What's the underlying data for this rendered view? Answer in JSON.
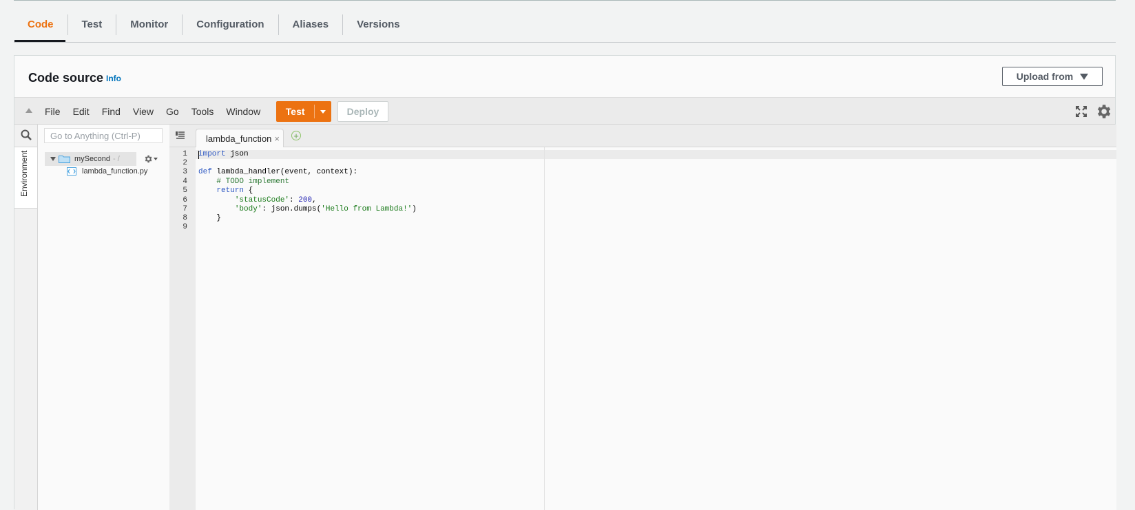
{
  "tabs": [
    {
      "label": "Code",
      "active": true
    },
    {
      "label": "Test"
    },
    {
      "label": "Monitor"
    },
    {
      "label": "Configuration"
    },
    {
      "label": "Aliases"
    },
    {
      "label": "Versions"
    }
  ],
  "code_source": {
    "title": "Code source",
    "info": "Info",
    "upload_label": "Upload from"
  },
  "ide_menu": [
    "File",
    "Edit",
    "Find",
    "View",
    "Go",
    "Tools",
    "Window"
  ],
  "toolbar": {
    "test_label": "Test",
    "deploy_label": "Deploy"
  },
  "sidebar": {
    "environment_label": "Environment",
    "goto_placeholder": "Go to Anything (Ctrl-P)"
  },
  "file_tree": {
    "root_name": "mySecond",
    "root_path": "- /",
    "file_name": "lambda_function.py"
  },
  "editor": {
    "tab_label": "lambda_function",
    "close_glyph": "×",
    "add_glyph": "+",
    "line_numbers": [
      "1",
      "2",
      "3",
      "4",
      "5",
      "6",
      "7",
      "8",
      "9"
    ],
    "lines": [
      "import json",
      "",
      "def lambda_handler(event, context):",
      "    # TODO implement",
      "    return {",
      "        'statusCode': 200,",
      "        'body': json.dumps('Hello from Lambda!')",
      "    }",
      ""
    ]
  },
  "colors": {
    "accent": "#ec7211",
    "link": "#0073bb",
    "keyword": "#2e58c2",
    "comment": "#2f7a37"
  }
}
